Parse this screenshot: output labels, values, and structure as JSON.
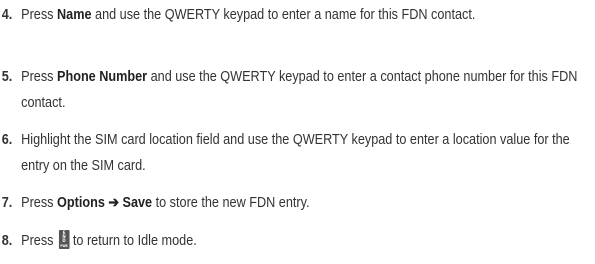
{
  "steps": [
    {
      "number": "4.",
      "pre": "Press ",
      "kw1": "Name",
      "post": " and use the QWERTY keypad to enter a name for this FDN contact."
    },
    {
      "number": "5.",
      "pre": "Press ",
      "kw1": "Phone Number",
      "post": " and use the QWERTY keypad to enter a contact phone number for this FDN contact."
    },
    {
      "number": "6.",
      "text": "Highlight the SIM card location field and use the QWERTY keypad to enter a location value for the entry on the SIM card."
    },
    {
      "number": "7.",
      "pre": "Press ",
      "kw1": "Options",
      "arrow": " ➔ ",
      "kw2": "Save",
      "post": " to store the new FDN entry."
    },
    {
      "number": "8.",
      "pre": "Press ",
      "key_icon": "end-power-key-icon",
      "key_lines": [
        "E",
        "N",
        "D",
        "PWR"
      ],
      "post": "to return to Idle mode."
    }
  ]
}
